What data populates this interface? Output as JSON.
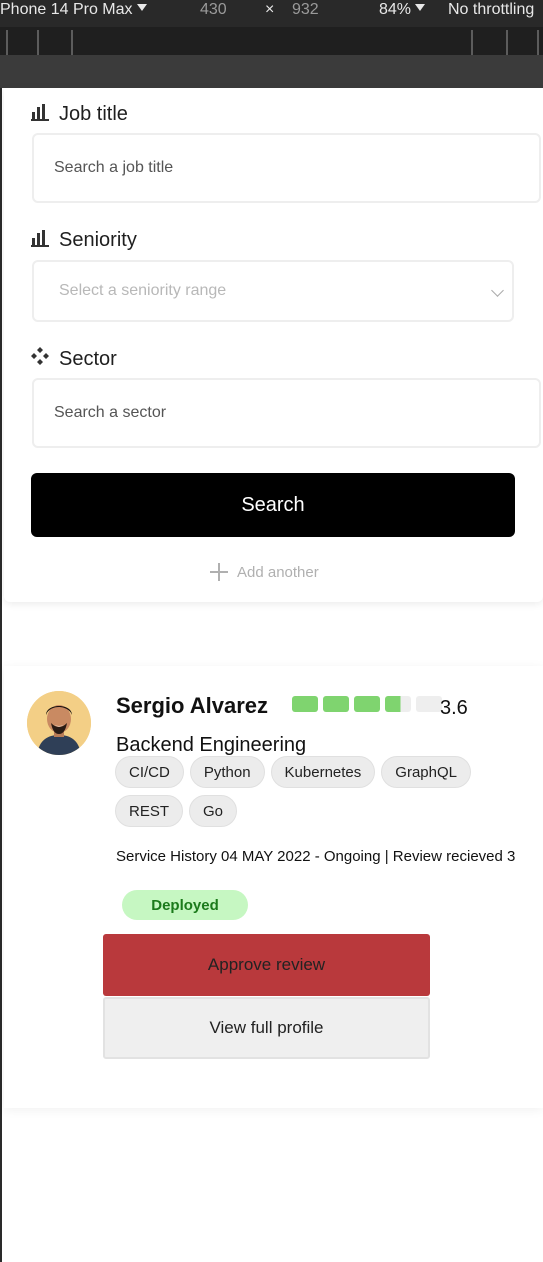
{
  "devtools": {
    "device": "Phone 14 Pro Max",
    "width": "430",
    "separator": "×",
    "height": "932",
    "zoom": "84%",
    "throttling": "No throttling"
  },
  "search": {
    "job_title": {
      "label": "Job title",
      "placeholder": "Search a job title",
      "icon": "bar-chart-icon"
    },
    "seniority": {
      "label": "Seniority",
      "placeholder": "Select a seniority range",
      "icon": "bar-chart-icon"
    },
    "sector": {
      "label": "Sector",
      "placeholder": "Search a sector",
      "icon": "diamonds-icon"
    },
    "search_button": "Search",
    "add_another": "Add another"
  },
  "profile": {
    "name": "Sergio Alvarez",
    "rating": 3.6,
    "rating_display": "3.6",
    "rating_max": 5,
    "role": "Backend Engineering",
    "tags": [
      "CI/CD",
      "Python",
      "Kubernetes",
      "GraphQL",
      "REST",
      "Go"
    ],
    "history": "Service History 04 MAY 2022 - Ongoing |   Review recieved   3",
    "status": "Deployed",
    "approve_button": "Approve review",
    "view_profile_button": "View full profile"
  },
  "colors": {
    "accent_black": "#000000",
    "approve_red": "#b9393c",
    "rating_green": "#7fd46f",
    "status_bg": "#c6f7c2",
    "status_text": "#1b7a1b"
  }
}
